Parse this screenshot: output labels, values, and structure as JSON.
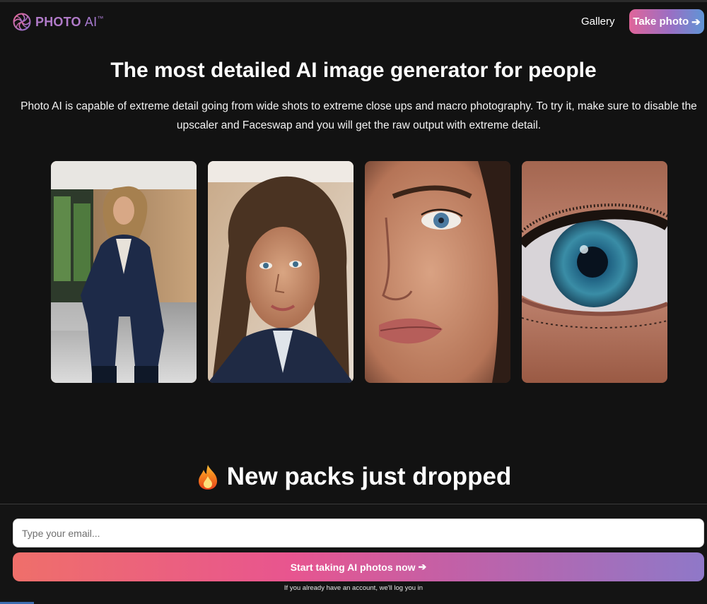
{
  "header": {
    "logo_text": "PHOTO",
    "logo_ai": "AI",
    "logo_tm": "™",
    "nav_gallery": "Gallery",
    "take_photo_label": "Take photo",
    "arrow": "➔"
  },
  "hero": {
    "title": "The most detailed AI image generator for people",
    "description": "Photo AI is capable of extreme detail going from wide shots to extreme close ups and macro photography. To try it, make sure to disable the upscaler and Faceswap and you will get the raw output with extreme detail."
  },
  "gallery": {
    "images": [
      {
        "icon": "woman-in-suit-full-body-photo"
      },
      {
        "icon": "woman-portrait-photo"
      },
      {
        "icon": "woman-face-close-up-photo"
      },
      {
        "icon": "eye-macro-photo"
      }
    ]
  },
  "packs": {
    "emoji_icon": "fire-icon",
    "title": "New packs just dropped"
  },
  "signup": {
    "email_placeholder": "Type your email...",
    "start_label": "Start taking AI photos now",
    "arrow": "➔",
    "login_note": "If you already have an account, we'll log you in"
  },
  "colors": {
    "background": "#121212",
    "logo": "#b07ac8",
    "button_gradient_start": "#ef6f6a",
    "button_gradient_end": "#8f78c8"
  }
}
